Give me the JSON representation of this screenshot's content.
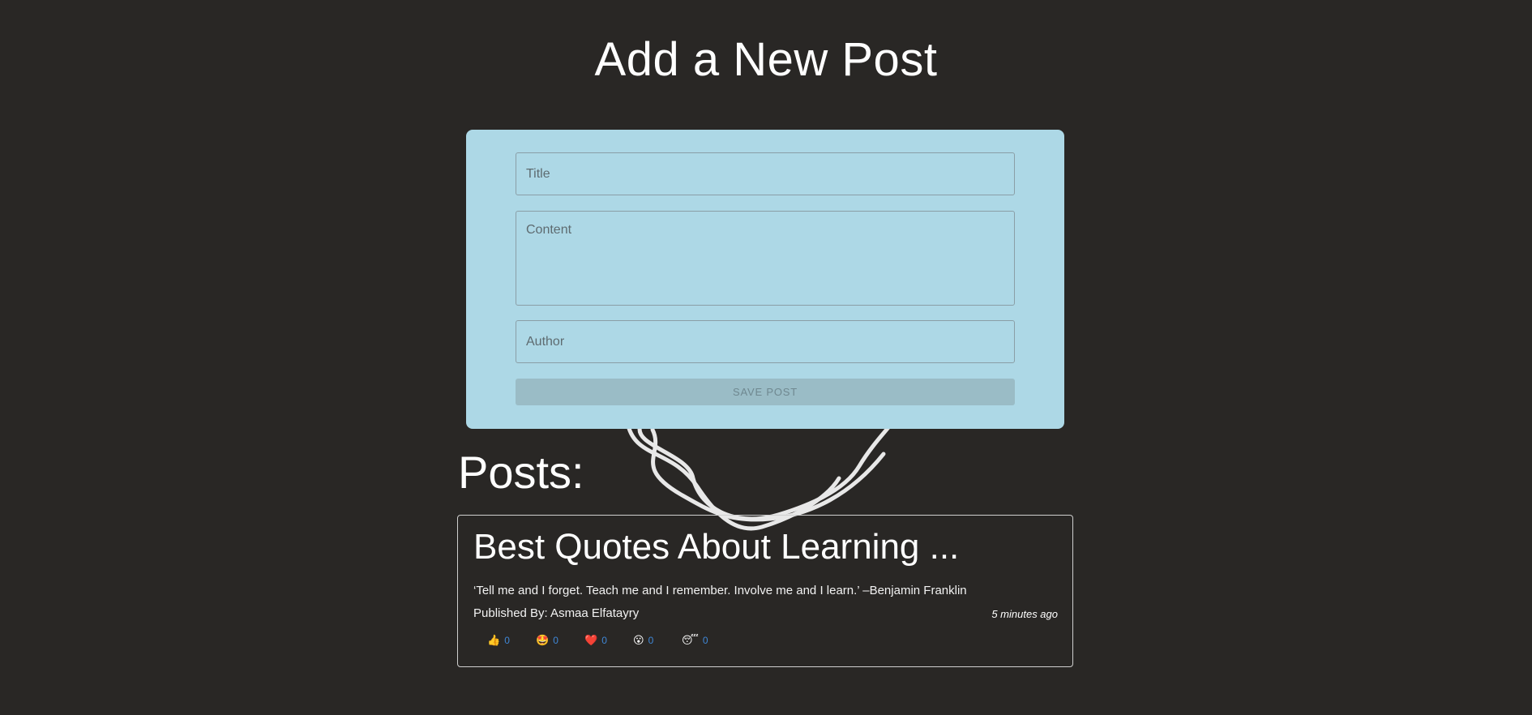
{
  "page": {
    "title": "Add a New Post"
  },
  "form": {
    "title_placeholder": "Title",
    "content_placeholder": "Content",
    "author_placeholder": "Author",
    "save_label": "SAVE POST"
  },
  "posts": {
    "heading": "Posts:",
    "items": [
      {
        "title": "Best Quotes About Learning ...",
        "content": "‘Tell me and I forget. Teach me and I remember. Involve me and I learn.’ –Benjamin Franklin",
        "published_by": "Published By: Asmaa Elfatayry",
        "time": "5 minutes ago",
        "reactions": [
          {
            "icon": "thumbs-up-icon",
            "emoji": "👍",
            "count": "0"
          },
          {
            "icon": "star-struck-icon",
            "emoji": "🤩",
            "count": "0"
          },
          {
            "icon": "heart-icon",
            "emoji": "❤️",
            "count": "0"
          },
          {
            "icon": "sad-face-icon",
            "emoji": "😮",
            "count": "0"
          },
          {
            "icon": "sleepy-face-icon",
            "emoji": "😴",
            "count": "0"
          }
        ]
      }
    ]
  },
  "colors": {
    "background": "#292725",
    "form_background": "#add8e6",
    "button_background": "#9abcc6",
    "reaction_count": "#3f87d6"
  }
}
